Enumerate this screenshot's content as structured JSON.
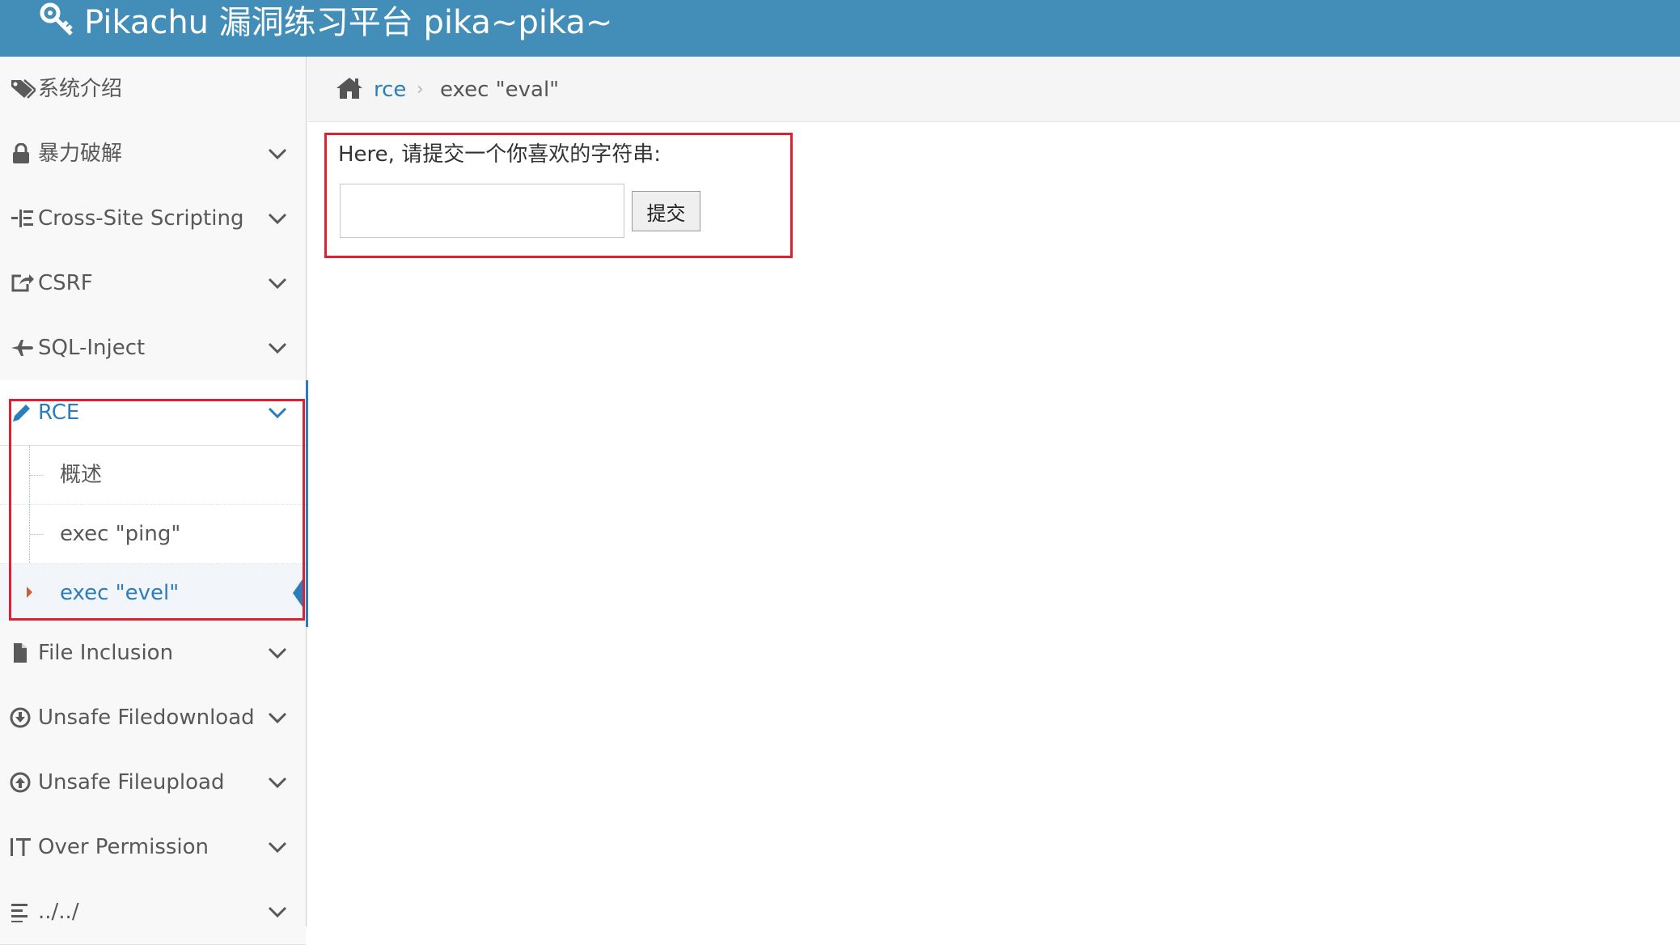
{
  "header": {
    "title": "Pikachu 漏洞练习平台 pika~pika~",
    "brand_icon": "key-icon"
  },
  "sidebar": {
    "items": [
      {
        "label": "系统介绍",
        "icon": "tags-icon",
        "has_caret": false
      },
      {
        "label": "暴力破解",
        "icon": "lock-icon",
        "has_caret": true
      },
      {
        "label": "Cross-Site Scripting",
        "icon": "list-indent-icon",
        "has_caret": true
      },
      {
        "label": "CSRF",
        "icon": "share-square-icon",
        "has_caret": true
      },
      {
        "label": "SQL-Inject",
        "icon": "plane-icon",
        "has_caret": true
      },
      {
        "label": "RCE",
        "icon": "pencil-icon",
        "has_caret": true,
        "active": true
      },
      {
        "label": "File Inclusion",
        "icon": "file-icon",
        "has_caret": true
      },
      {
        "label": "Unsafe Filedownload",
        "icon": "download-circle-icon",
        "has_caret": true
      },
      {
        "label": "Unsafe Fileupload",
        "icon": "upload-circle-icon",
        "has_caret": true
      },
      {
        "label": "Over Permission",
        "icon": "text-height-icon",
        "has_caret": true
      },
      {
        "label": "../../",
        "icon": "align-left-icon",
        "has_caret": true
      }
    ],
    "rce_submenu": [
      {
        "label": "概述"
      },
      {
        "label": "exec \"ping\""
      },
      {
        "label": "exec \"evel\"",
        "active": true
      }
    ]
  },
  "breadcrumb": {
    "home_icon": "home-icon",
    "link": "rce",
    "separator": "›",
    "current": "exec \"eval\""
  },
  "form": {
    "prompt": "Here, 请提交一个你喜欢的字符串:",
    "input_value": "",
    "submit_label": "提交"
  },
  "colors": {
    "header_bg": "#438eb9",
    "accent": "#2b7dbc",
    "highlight_border": "#e02030"
  }
}
